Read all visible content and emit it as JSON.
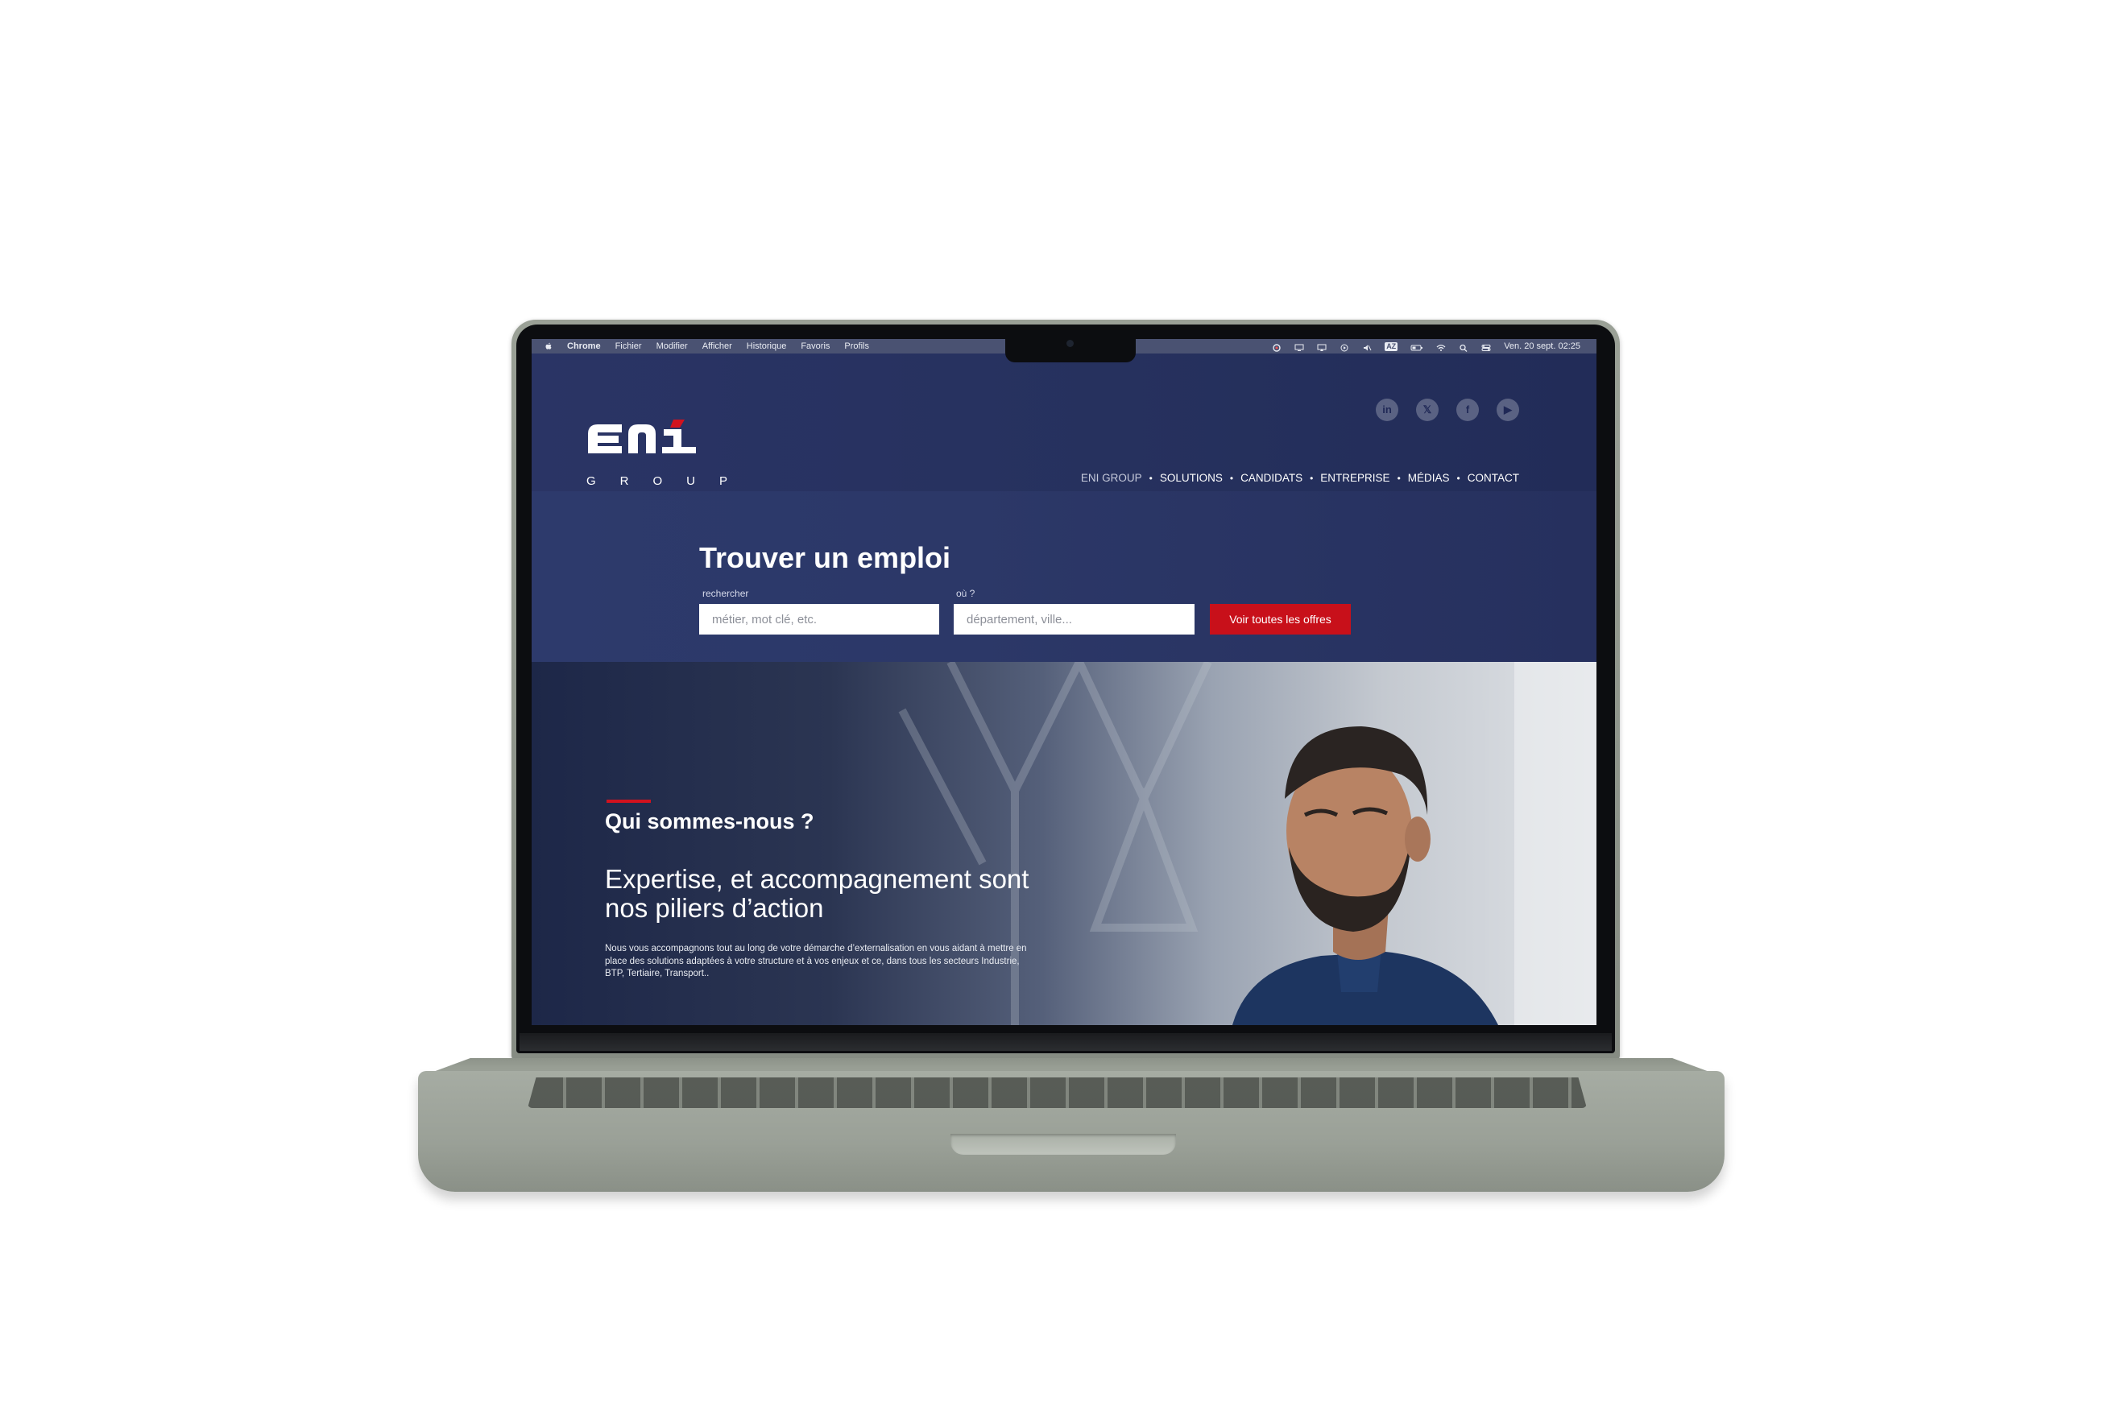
{
  "menubar": {
    "app": "Chrome",
    "items": [
      "Fichier",
      "Modifier",
      "Afficher",
      "Historique",
      "Favoris",
      "Profils"
    ],
    "input_badge": "AZ",
    "datetime": "Ven. 20 sept. 02:25"
  },
  "site": {
    "logo_text": "ENI",
    "logo_subtitle": "GROUP",
    "social": [
      {
        "icon": "linkedin-icon",
        "glyph": "in"
      },
      {
        "icon": "x-icon",
        "glyph": "𝕏"
      },
      {
        "icon": "facebook-icon",
        "glyph": "f"
      },
      {
        "icon": "youtube-icon",
        "glyph": "▶"
      }
    ],
    "nav": [
      "ENI GROUP",
      "SOLUTIONS",
      "CANDIDATS",
      "ENTREPRISE",
      "MÉDIAS",
      "CONTACT"
    ]
  },
  "search": {
    "title": "Trouver un emploi",
    "what_label": "rechercher",
    "what_placeholder": "métier, mot clé, etc.",
    "where_label": "où ?",
    "where_placeholder": "département, ville...",
    "button": "Voir toutes les offres"
  },
  "hero": {
    "kicker": "Qui sommes-nous ?",
    "title": "Expertise, et accompagnement sont nos piliers d’action",
    "body": "Nous vous accompagnons tout au long de votre démarche d’externalisation en vous aidant à mettre en place des solutions adaptées à votre structure et à vos enjeux et ce, dans tous les secteurs Industrie, BTP, Tertiaire, Transport.."
  },
  "colors": {
    "brand_navy": "#26315e",
    "brand_red": "#c8101a",
    "laptop_body": "#9aa097"
  }
}
